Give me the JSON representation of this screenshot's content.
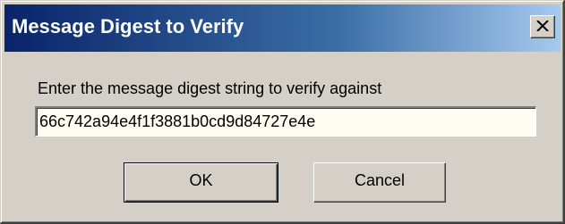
{
  "window": {
    "title": "Message Digest to Verify"
  },
  "dialog": {
    "prompt": "Enter the message digest string to verify against",
    "digest_value": "66c742a94e4f1f3881b0cd9d84727e4e"
  },
  "buttons": {
    "ok_label": "OK",
    "cancel_label": "Cancel"
  },
  "icons": {
    "close": "close-icon"
  },
  "colors": {
    "titlebar_start": "#0a246a",
    "titlebar_end": "#a6caf0",
    "window_face": "#d4d0c8",
    "input_background": "#fffcf2"
  }
}
